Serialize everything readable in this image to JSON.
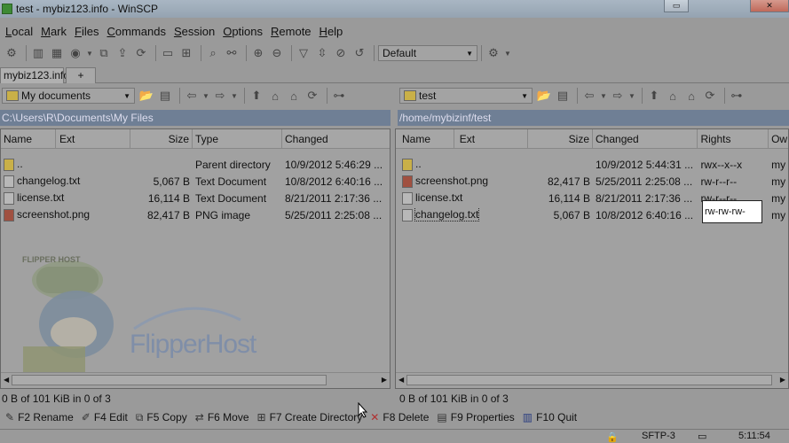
{
  "window": {
    "title": "test - mybiz123.info - WinSCP"
  },
  "menu": [
    "Local",
    "Mark",
    "Files",
    "Commands",
    "Session",
    "Options",
    "Remote",
    "Help"
  ],
  "toolbar": {
    "transfer_profile": "Default"
  },
  "tabs": {
    "session": "mybiz123.info",
    "new": "+"
  },
  "left": {
    "location": "My documents",
    "path": "C:\\Users\\R\\Documents\\My Files",
    "columns": [
      "Name",
      "Ext",
      "Size",
      "Type",
      "Changed"
    ],
    "rows": [
      {
        "name": "..",
        "size": "",
        "type": "Parent directory",
        "changed": "10/9/2012  5:46:29 ..."
      },
      {
        "name": "changelog.txt",
        "size": "5,067 B",
        "type": "Text Document",
        "changed": "10/8/2012  6:40:16 ..."
      },
      {
        "name": "license.txt",
        "size": "16,114 B",
        "type": "Text Document",
        "changed": "8/21/2011  2:17:36 ..."
      },
      {
        "name": "screenshot.png",
        "size": "82,417 B",
        "type": "PNG image",
        "changed": "5/25/2011  2:25:08 ..."
      }
    ],
    "status": "0 B of 101 KiB in 0 of 3"
  },
  "right": {
    "location": "test",
    "path": "/home/mybizinf/test",
    "columns": [
      "Name",
      "Ext",
      "Size",
      "Changed",
      "Rights",
      "Ow"
    ],
    "rows": [
      {
        "name": "..",
        "size": "",
        "changed": "10/9/2012  5:44:31 ...",
        "rights": "rwx--x--x",
        "owner": "my"
      },
      {
        "name": "screenshot.png",
        "size": "82,417 B",
        "changed": "5/25/2011  2:25:08 ...",
        "rights": "rw-r--r--",
        "owner": "my"
      },
      {
        "name": "license.txt",
        "size": "16,114 B",
        "changed": "8/21/2011  2:17:36 ...",
        "rights": "rw-r--r--",
        "owner": "my"
      },
      {
        "name": "changelog.txt",
        "size": "5,067 B",
        "changed": "10/8/2012  6:40:16 ...",
        "rights": "rw-rw-rw-",
        "owner": "my"
      }
    ],
    "status": "0 B of 101 KiB in 0 of 3"
  },
  "fkeys": [
    {
      "label": "F2 Rename",
      "icon": "rename-icon"
    },
    {
      "label": "F4 Edit",
      "icon": "edit-icon"
    },
    {
      "label": "F5 Copy",
      "icon": "copy-icon"
    },
    {
      "label": "F6 Move",
      "icon": "move-icon"
    },
    {
      "label": "F7 Create Directory",
      "icon": "folder-new-icon"
    },
    {
      "label": "F8 Delete",
      "icon": "delete-icon"
    },
    {
      "label": "F9 Properties",
      "icon": "properties-icon"
    },
    {
      "label": "F10 Quit",
      "icon": "quit-icon"
    }
  ],
  "statusbar": {
    "protocol": "SFTP-3",
    "time": "5:11:54"
  },
  "logo": {
    "text": "FlipperHost",
    "cap_text": "FLIPPER HOST"
  },
  "colors": {
    "path_bar": "#6f7f95",
    "title_bar": "#a9b6c3",
    "delete_icon": "#b03030"
  }
}
